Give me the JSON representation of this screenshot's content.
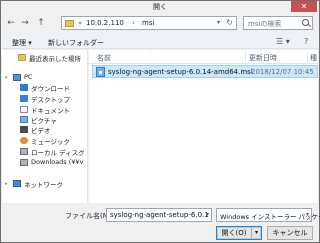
{
  "window": {
    "title": "開く",
    "close_glyph": "✕"
  },
  "nav": {
    "back_glyph": "←",
    "forward_glyph": "→",
    "up_glyph": "↑"
  },
  "address": {
    "chevron": "«",
    "segments": [
      "10.0.2.110",
      "msi"
    ],
    "separator": "›",
    "dropdown_glyph": "▾",
    "refresh_glyph": "↻"
  },
  "search": {
    "placeholder": "msiの検索"
  },
  "toolbar": {
    "organize": "整理 ▾",
    "new_folder": "新しいフォルダー",
    "view_glyph": "☰ ▾",
    "help_glyph": "?"
  },
  "sidebar": {
    "items": [
      {
        "label": "最近表示した場所",
        "icon": "recent-places-icon"
      },
      {
        "label": "PC",
        "icon": "pc-icon"
      },
      {
        "label": "ダウンロード",
        "icon": "downloads-icon"
      },
      {
        "label": "デスクトップ",
        "icon": "desktop-icon"
      },
      {
        "label": "ドキュメント",
        "icon": "documents-icon"
      },
      {
        "label": "ピクチャ",
        "icon": "pictures-icon"
      },
      {
        "label": "ビデオ",
        "icon": "videos-icon"
      },
      {
        "label": "ミュージック",
        "icon": "music-icon"
      },
      {
        "label": "ローカル ディスク (C",
        "icon": "local-disk-icon"
      },
      {
        "label": "Downloads (¥¥v",
        "icon": "network-drive-icon"
      },
      {
        "label": "ネットワーク",
        "icon": "network-icon"
      }
    ]
  },
  "filelist": {
    "columns": {
      "name": "名前",
      "modified": "更新日時",
      "type": "種"
    },
    "files": [
      {
        "name": "syslog-ng-agent-setup-6.0.14-amd64.msi",
        "modified": "2018/12/07 10:45",
        "type": "W"
      }
    ]
  },
  "footer": {
    "filename_label": "ファイル名(N):",
    "filename_value": "syslog-ng-agent-setup-6.0.1",
    "filter_value": "Windows インストーラー パッケージ",
    "open_label": "開く(O)",
    "cancel_label": "キャンセル"
  }
}
